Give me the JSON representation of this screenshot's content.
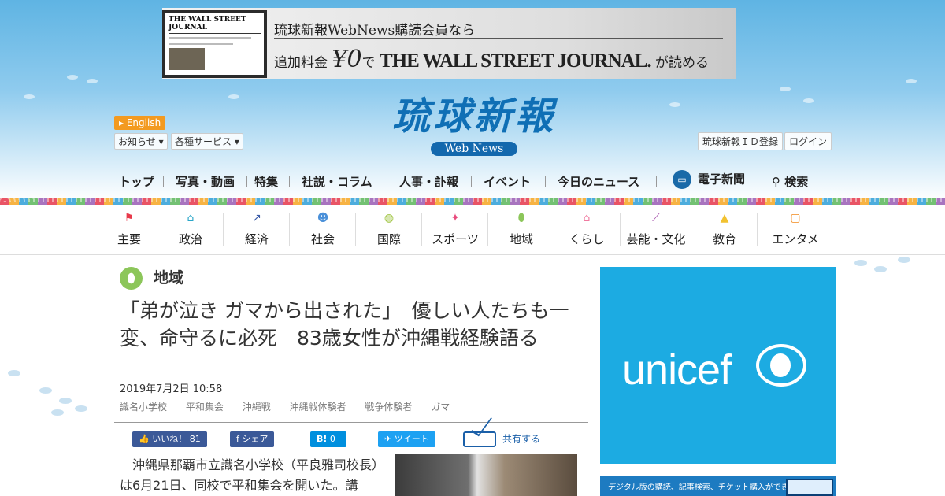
{
  "banner": {
    "paper_name": "THE WALL STREET JOURNAL",
    "line1": "琉球新報WebNews購読会員なら",
    "line2_prefix": "追加料金",
    "price": "¥0",
    "line2_mid": "で",
    "brand": "THE WALL STREET JOURNAL.",
    "line2_suffix": "が読める"
  },
  "logo": {
    "name": "琉球新報",
    "sub": "Web News"
  },
  "header": {
    "english": "English",
    "notices": "お知らせ",
    "services": "各種サービス",
    "id_register": "琉球新報ＩＤ登録",
    "login": "ログイン"
  },
  "main_nav": {
    "items": [
      "トップ",
      "写真・動画",
      "特集",
      "社説・コラム",
      "人事・訃報",
      "イベント",
      "今日のニュース",
      "電子新聞",
      "検索"
    ]
  },
  "category_nav": {
    "items": [
      {
        "label": "主要",
        "icon": "flag-icon",
        "color": "#e8394a"
      },
      {
        "label": "政治",
        "icon": "parliament-icon",
        "color": "#2aa6c8"
      },
      {
        "label": "経済",
        "icon": "chart-icon",
        "color": "#3a5ba8"
      },
      {
        "label": "社会",
        "icon": "people-icon",
        "color": "#4a90d9"
      },
      {
        "label": "国際",
        "icon": "globe-icon",
        "color": "#9cc23b"
      },
      {
        "label": "スポーツ",
        "icon": "runner-icon",
        "color": "#e84a7d"
      },
      {
        "label": "地域",
        "icon": "pin-icon",
        "color": "#8cc65a"
      },
      {
        "label": "くらし",
        "icon": "house-icon",
        "color": "#f07aa0"
      },
      {
        "label": "芸能・文化",
        "icon": "brush-icon",
        "color": "#a24aa8"
      },
      {
        "label": "教育",
        "icon": "graduation-cap-icon",
        "color": "#f2c230"
      },
      {
        "label": "エンタメ",
        "icon": "tv-icon",
        "color": "#f28a1e"
      }
    ]
  },
  "article": {
    "region": "地域",
    "title": "「弟が泣き ガマから出された」　優しい人たちも一変、命守るに必死　83歳女性が沖縄戦経験語る",
    "date": "2019年7月2日 10:58",
    "tags": [
      "識名小学校",
      "平和集会",
      "沖縄戦",
      "沖縄戦体験者",
      "戦争体験者",
      "ガマ"
    ],
    "body": "　沖縄県那覇市立識名小学校（平良雅司校長）は6月21日、同校で平和集会を開いた。講"
  },
  "share_bar": {
    "like_label": "いいね！",
    "like_count": "81",
    "facebook_share": "シェア",
    "hatena_label": "B!",
    "hatena_count": "0",
    "tweet": "ツイート",
    "share": "共有する"
  },
  "ads": {
    "unicef_word": "unicef",
    "digital_text": "デジタル版の購読、記事検索、チケット購入ができる"
  },
  "colors": {
    "logo_blue": "#0f6fb5",
    "english_orange": "#f39a20",
    "unicef_blue": "#1cabe2",
    "facebook_blue": "#3b5998",
    "twitter_blue": "#1da1f2",
    "hatena_blue": "#008fde"
  }
}
